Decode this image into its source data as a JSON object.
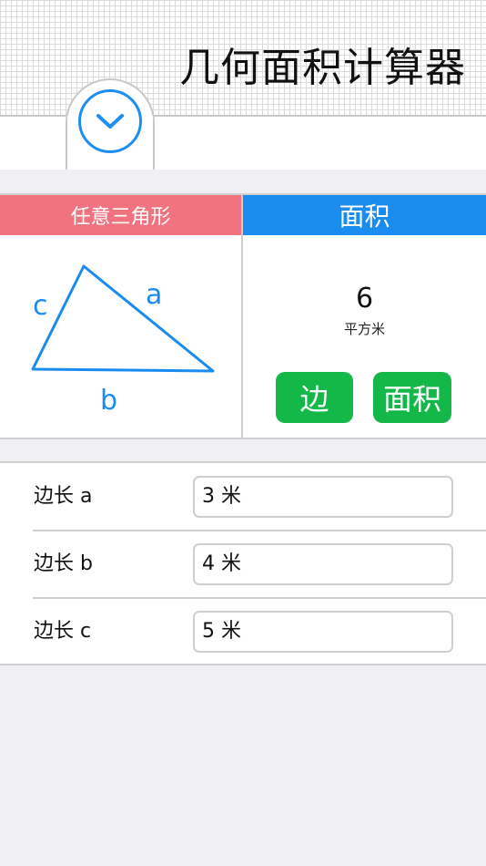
{
  "header": {
    "title": "几何面积计算器",
    "toggle_icon": "chevron-down-icon"
  },
  "shape": {
    "label": "任意三角形",
    "side_a": "a",
    "side_b": "b",
    "side_c": "c"
  },
  "result": {
    "label": "面积",
    "value": "6",
    "unit": "平方米"
  },
  "actions": {
    "side_label": "边",
    "area_label": "面积"
  },
  "inputs": [
    {
      "label": "边长 a",
      "value": "3 米"
    },
    {
      "label": "边长 b",
      "value": "4 米"
    },
    {
      "label": "边长 c",
      "value": "5 米"
    }
  ],
  "colors": {
    "accent_blue": "#1a8cf0",
    "shape_pink": "#f0737f",
    "button_green": "#14b848"
  }
}
